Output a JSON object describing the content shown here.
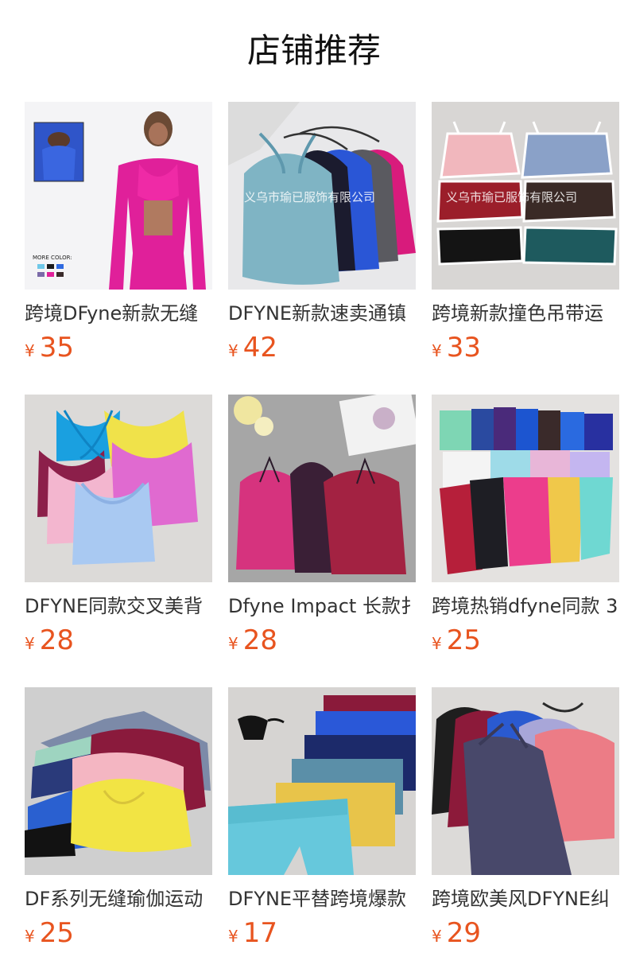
{
  "header": {
    "title": "店铺推荐"
  },
  "products": [
    {
      "name": "跨境DFyne新款无缝",
      "currency": "¥",
      "price": "35",
      "image_text": "MORE COLOR:"
    },
    {
      "name": "DFYNE新款速卖通镇",
      "currency": "¥",
      "price": "42",
      "image_text": "义乌市瑜已服饰有限公司"
    },
    {
      "name": "跨境新款撞色吊带运",
      "currency": "¥",
      "price": "33",
      "image_text": "义乌市瑜已服饰有限公司"
    },
    {
      "name": "DFYNE同款交叉美背",
      "currency": "¥",
      "price": "28"
    },
    {
      "name": "Dfyne Impact 长款扌",
      "currency": "¥",
      "price": "28"
    },
    {
      "name": "跨境热销dfyne同款 3",
      "currency": "¥",
      "price": "25"
    },
    {
      "name": "DF系列无缝瑜伽运动",
      "currency": "¥",
      "price": "25"
    },
    {
      "name": "DFYNE平替跨境爆款",
      "currency": "¥",
      "price": "17"
    },
    {
      "name": "跨境欧美风DFYNE纠",
      "currency": "¥",
      "price": "29"
    }
  ],
  "colors": {
    "price": "#e8541f",
    "title": "#111111",
    "name": "#333333"
  }
}
